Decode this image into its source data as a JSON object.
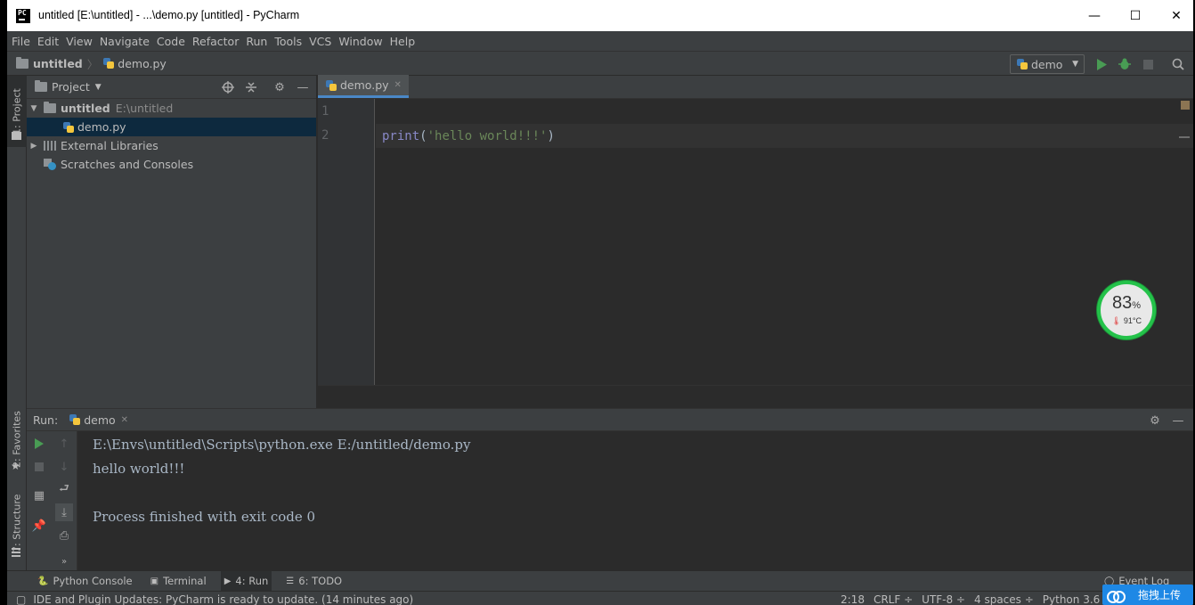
{
  "window": {
    "title": "untitled [E:\\untitled] - ...\\demo.py [untitled] - PyCharm",
    "app_icon_text": "PC",
    "minimize": "—",
    "maximize": "☐",
    "close": "✕"
  },
  "menu": [
    "File",
    "Edit",
    "View",
    "Navigate",
    "Code",
    "Refactor",
    "Run",
    "Tools",
    "VCS",
    "Window",
    "Help"
  ],
  "breadcrumb": {
    "project": "untitled",
    "file": "demo.py"
  },
  "run_config": {
    "name": "demo"
  },
  "left_stripe": {
    "project_tab": "1: Project",
    "favorites_tab": "2: Favorites",
    "structure_tab": "7: Structure"
  },
  "project_panel": {
    "title": "Project",
    "tree": {
      "root_name": "untitled",
      "root_path": "E:\\untitled",
      "file": "demo.py",
      "external_libraries": "External Libraries",
      "scratches": "Scratches and Consoles"
    }
  },
  "editor": {
    "tab_label": "demo.py",
    "line_numbers": [
      "1",
      "2"
    ],
    "code": {
      "fn": "print",
      "open": "(",
      "str": "'hello world!!!'",
      "close": ")"
    }
  },
  "temperature_widget": {
    "percent": "83",
    "percent_sign": "%",
    "temp": "91°C"
  },
  "run_panel": {
    "label": "Run:",
    "tab": "demo",
    "console_lines": [
      "E:\\Envs\\untitled\\Scripts\\python.exe E:/untitled/demo.py",
      "hello world!!!",
      "",
      "Process finished with exit code 0"
    ]
  },
  "bottom_tabs": {
    "python_console": "Python Console",
    "terminal": "Terminal",
    "run": "4: Run",
    "todo": "6: TODO",
    "event_log": "Event Log"
  },
  "status": {
    "message": "IDE and Plugin Updates: PyCharm is ready to update. (14 minutes ago)",
    "position": "2:18",
    "line_sep": "CRLF ÷",
    "encoding": "UTF-8 ÷",
    "indent": "4 spaces ÷",
    "interpreter": "Python 3.6 (un"
  },
  "upload_button": {
    "label": "拖拽上传"
  },
  "colors": {
    "accent": "#4a88c7",
    "run_green": "#499c54",
    "background": "#2b2b2b",
    "panel": "#3c3f41"
  }
}
